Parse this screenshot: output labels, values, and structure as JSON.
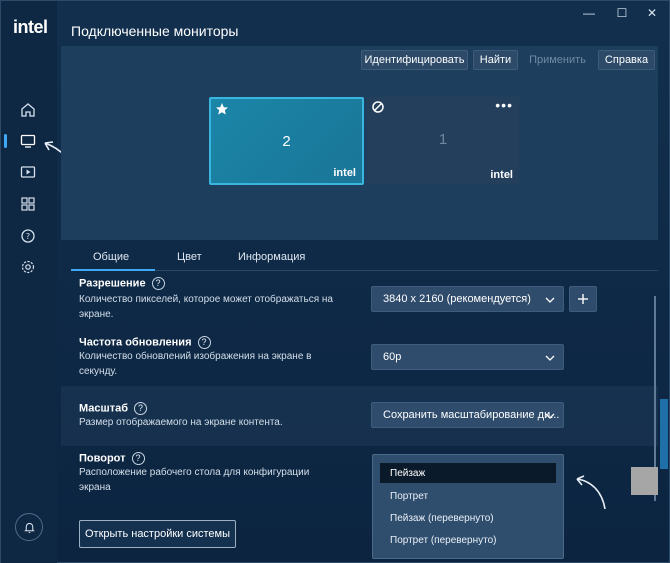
{
  "sidebar": {
    "logo": "intel",
    "items": [
      {
        "name": "home",
        "icon": "home-icon"
      },
      {
        "name": "display",
        "icon": "monitor-icon",
        "active": true
      },
      {
        "name": "video",
        "icon": "video-icon"
      },
      {
        "name": "apps",
        "icon": "grid-icon"
      },
      {
        "name": "help",
        "icon": "help-icon"
      },
      {
        "name": "settings",
        "icon": "gear-icon"
      }
    ],
    "notification_icon": "bell-icon"
  },
  "window_controls": {
    "minimize": "—",
    "maximize": "☐",
    "close": "✕"
  },
  "page": {
    "title": "Подключенные мониторы"
  },
  "toolbar": {
    "identify": "Идентифицировать",
    "find": "Найти",
    "apply": "Применить",
    "help": "Справка"
  },
  "monitors": [
    {
      "number": "2",
      "brand": "intel",
      "primary": true,
      "icon": "star-icon"
    },
    {
      "number": "1",
      "brand": "intel",
      "primary": false,
      "icon": "disabled-icon",
      "menu": "•••"
    }
  ],
  "tabs": [
    {
      "label": "Общие",
      "active": true
    },
    {
      "label": "Цвет"
    },
    {
      "label": "Информация"
    }
  ],
  "settings": {
    "resolution": {
      "title": "Разрешение",
      "desc": "Количество пикселей, которое может отображаться на экране.",
      "value": "3840 x 2160 (рекомендуется)"
    },
    "refresh": {
      "title": "Частота обновления",
      "desc": "Количество обновлений изображения на экране в секунду.",
      "value": "60p"
    },
    "scale": {
      "title": "Масштаб",
      "desc": "Размер отображаемого на экране контента.",
      "value": "Сохранить масштабирование ди..."
    },
    "rotation": {
      "title": "Поворот",
      "desc": "Расположение рабочего стола для конфигурации экрана",
      "options": [
        "Пейзаж",
        "Портрет",
        "Пейзаж (перевернуто)",
        "Портрет (перевернуто)"
      ],
      "selected": "Пейзаж"
    }
  },
  "open_system_settings": "Открыть настройки системы",
  "help_glyph": "?",
  "colors": {
    "accent": "#3fa9f5",
    "primary_monitor": "#1b86a8"
  }
}
